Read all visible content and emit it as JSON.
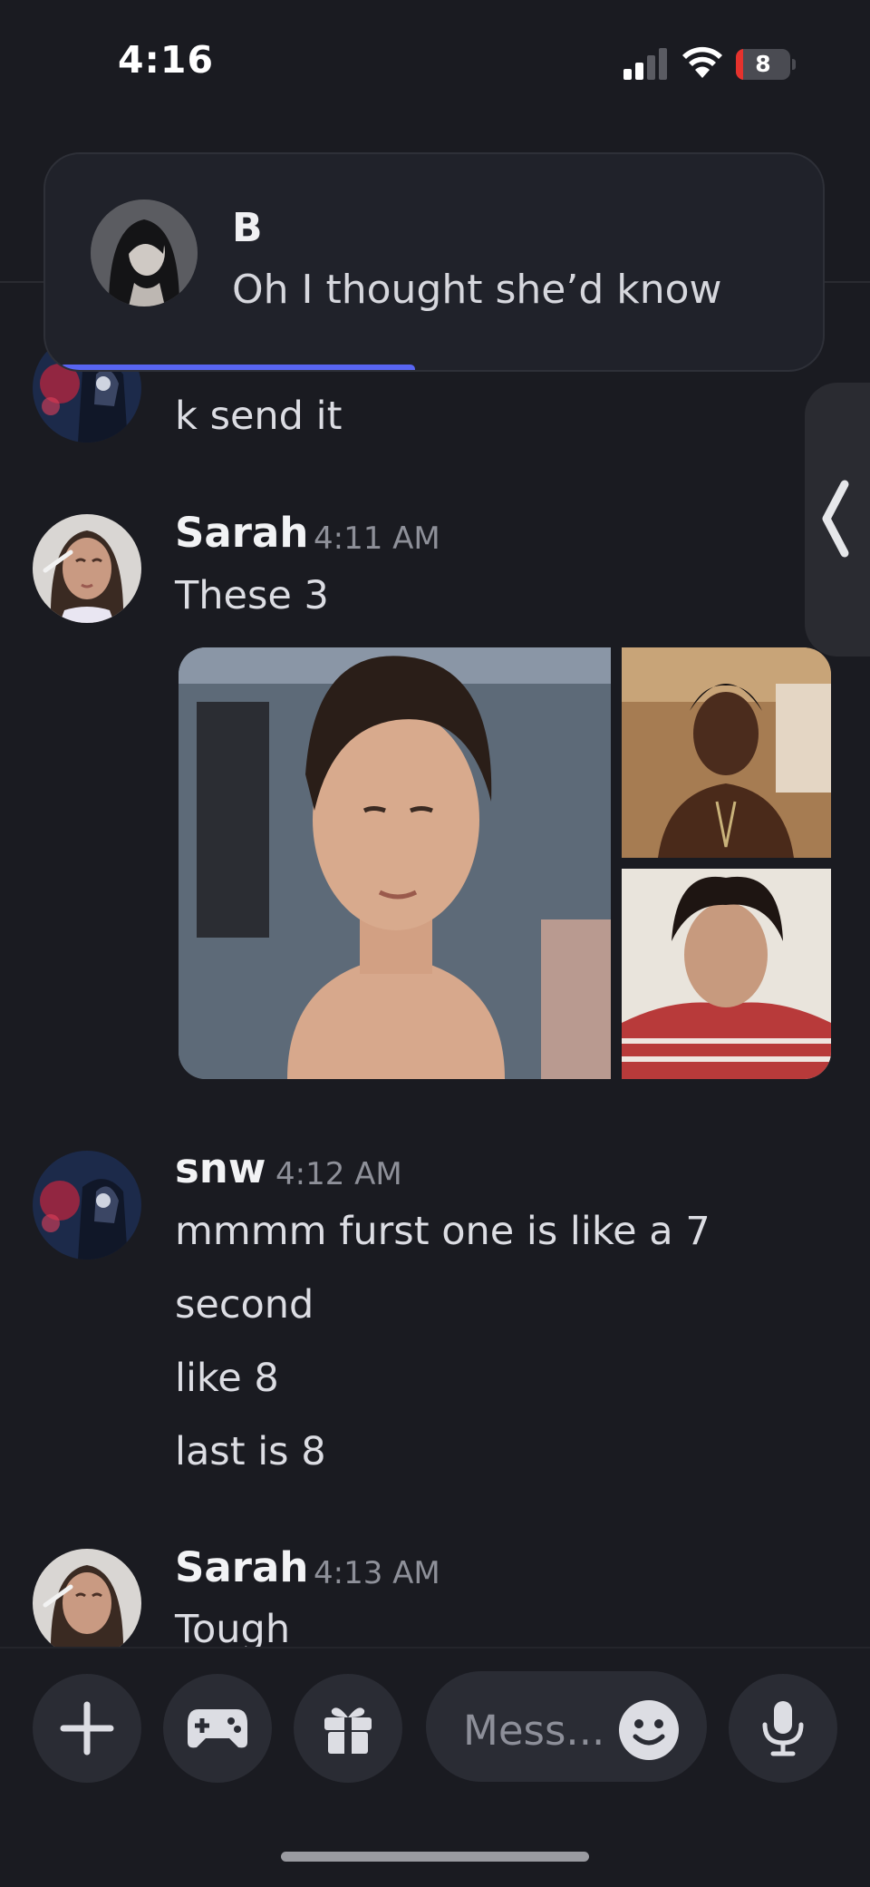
{
  "status_bar": {
    "time": "4:16",
    "battery_level": "8"
  },
  "notification": {
    "sender": "B",
    "message": "Oh I thought she’d know"
  },
  "messages": [
    {
      "text": "k send it"
    },
    {
      "author": "Sarah",
      "timestamp": "4:11 AM",
      "lines": [
        "These 3"
      ],
      "attachments": [
        "photo-1",
        "photo-2",
        "photo-3"
      ]
    },
    {
      "author": "snw",
      "timestamp": "4:12 AM",
      "lines": [
        "mmmm furst one is like a 7",
        "second",
        "like 8",
        "last is 8"
      ]
    },
    {
      "author": "Sarah",
      "timestamp": "4:13 AM",
      "lines": [
        "Tough"
      ]
    }
  ],
  "composer": {
    "placeholder": "Mess...",
    "buttons": [
      "plus-icon",
      "gamepad-icon",
      "gift-icon",
      "emoji-icon",
      "microphone-icon"
    ]
  },
  "colors": {
    "background": "#1a1b21",
    "accent": "#5865f2",
    "surface": "#2a2c34"
  }
}
